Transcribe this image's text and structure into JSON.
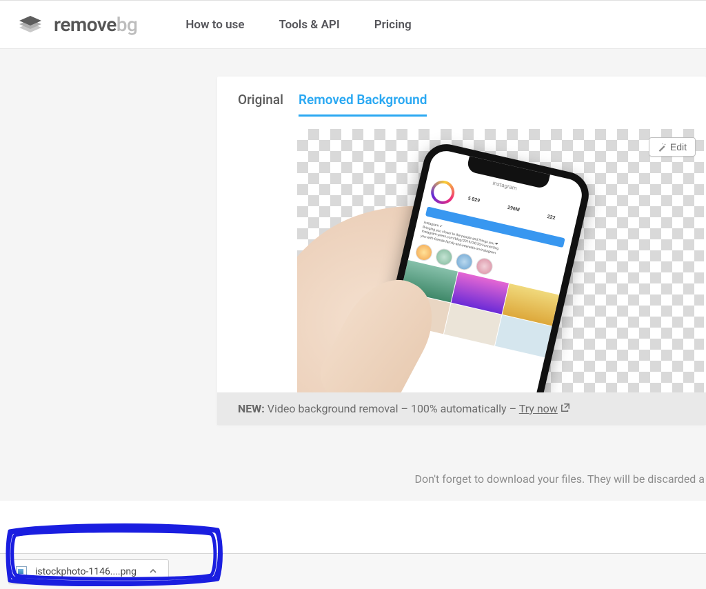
{
  "brand": {
    "part1": "remove",
    "part2": "bg"
  },
  "nav": {
    "how": "How to use",
    "tools": "Tools & API",
    "pricing": "Pricing"
  },
  "tabs": {
    "original": "Original",
    "removed": "Removed Background"
  },
  "edit": {
    "label": "Edit"
  },
  "ig": {
    "title": "instagram",
    "stats": {
      "posts": "5 829",
      "followers": "296M",
      "following": "222"
    },
    "handle": "instagram"
  },
  "banner": {
    "prefix": "NEW:",
    "text": " Video background removal – 100% automatically – ",
    "cta": "Try now"
  },
  "reminder": "Don't forget to download your files. They will be discarded a",
  "download": {
    "filename": "istockphoto-1146....png"
  }
}
